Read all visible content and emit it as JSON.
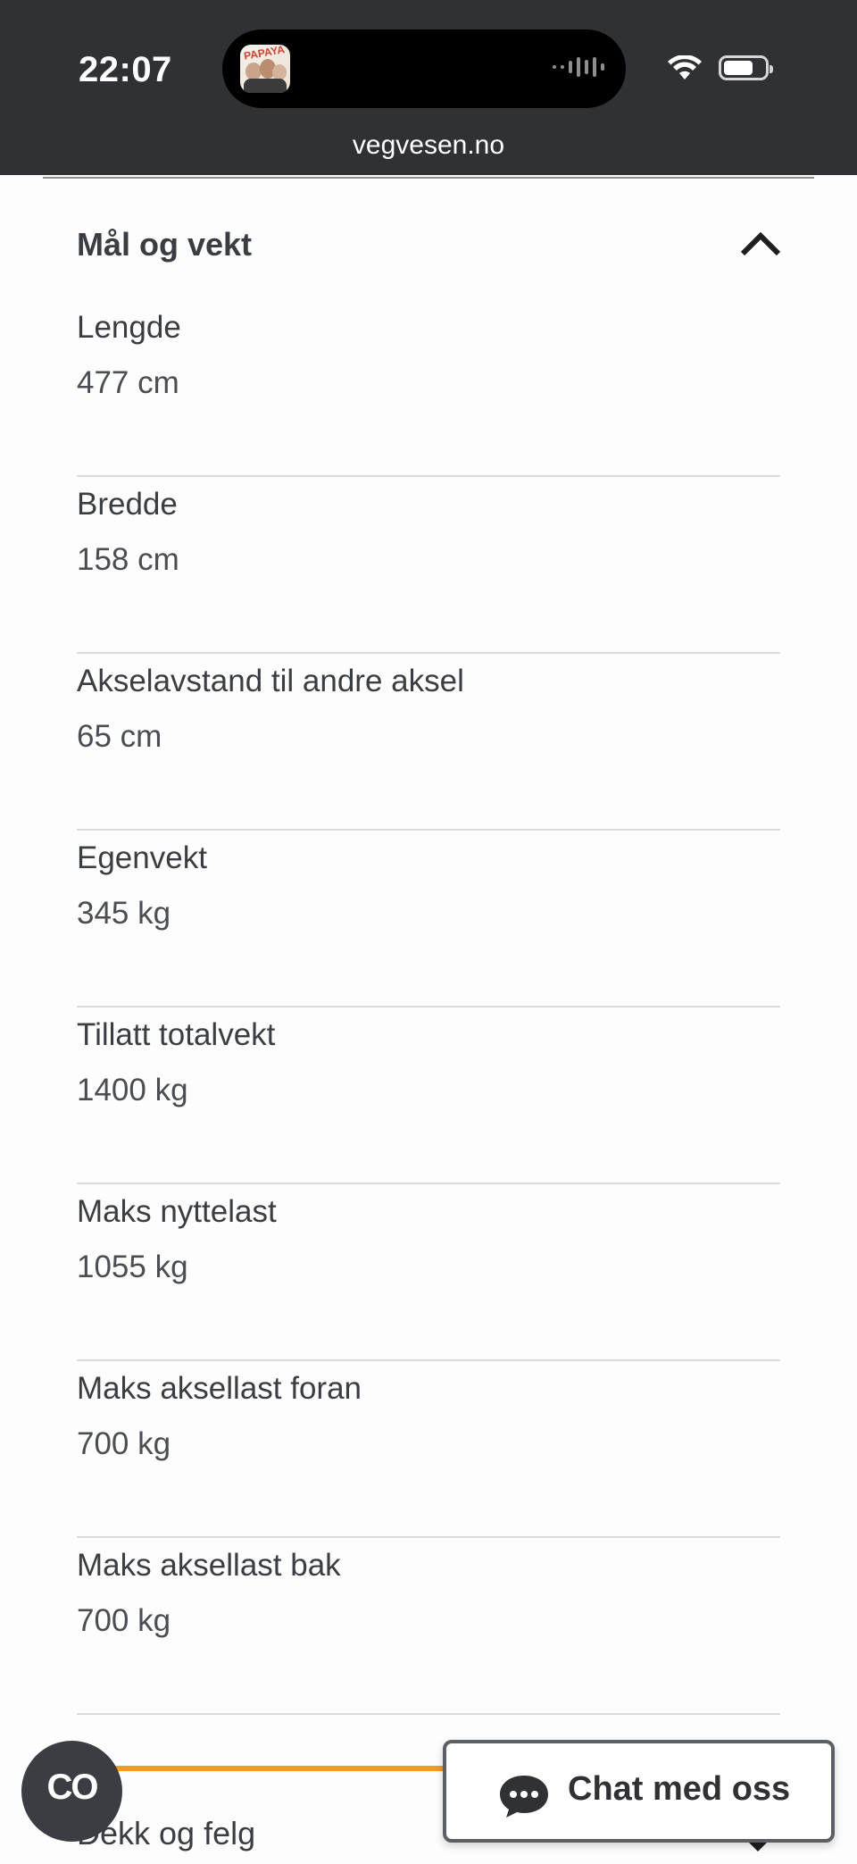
{
  "status_bar": {
    "time": "22:07",
    "url": "vegvesen.no"
  },
  "section": {
    "title": "Mål og vekt",
    "rows": [
      {
        "label": "Lengde",
        "value": "477 cm"
      },
      {
        "label": "Bredde",
        "value": "158 cm"
      },
      {
        "label": "Akselavstand til andre aksel",
        "value": "65 cm"
      },
      {
        "label": "Egenvekt",
        "value": "345 kg"
      },
      {
        "label": "Tillatt totalvekt",
        "value": "1400 kg"
      },
      {
        "label": "Maks nyttelast",
        "value": "1055 kg"
      },
      {
        "label": "Maks aksellast foran",
        "value": "700 kg"
      },
      {
        "label": "Maks aksellast bak",
        "value": "700 kg"
      }
    ]
  },
  "next_section": {
    "title": "Dekk og felg"
  },
  "fab": {
    "label": "CO"
  },
  "chat": {
    "label": "Chat med oss"
  },
  "colors": {
    "status_bar_bg": "#2f3134",
    "accent_orange": "#f39c20",
    "text": "#3a3d42"
  }
}
